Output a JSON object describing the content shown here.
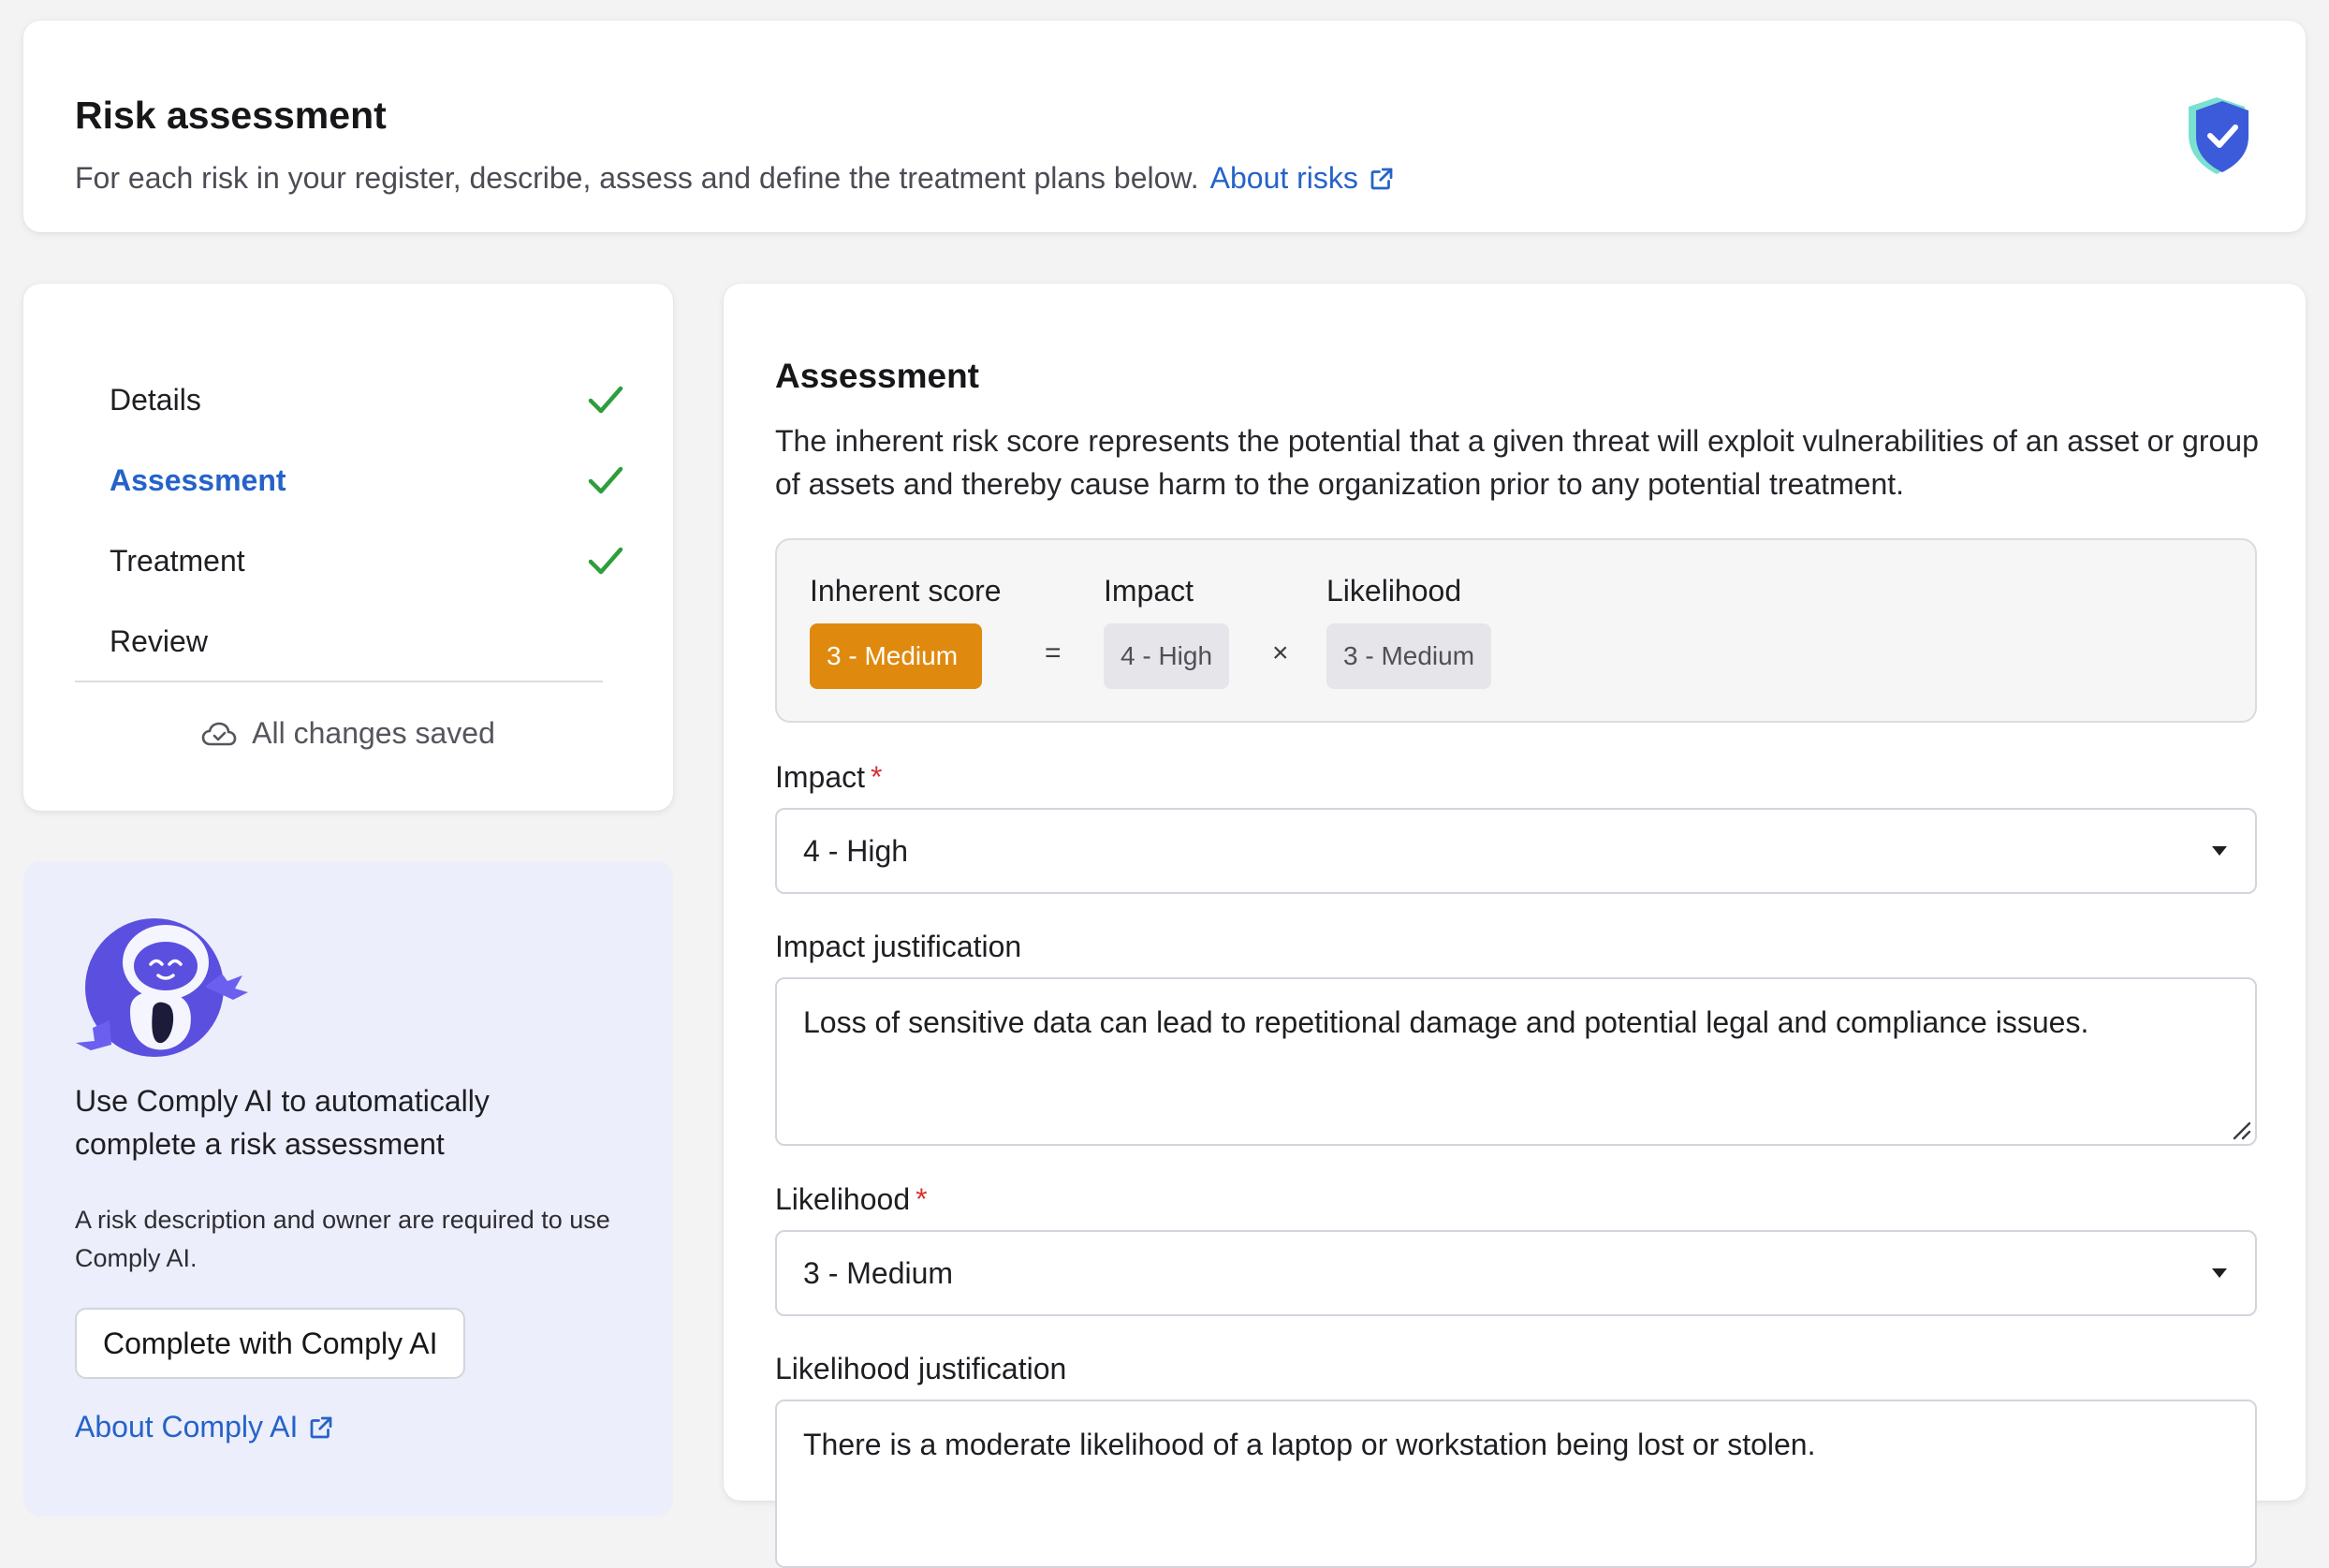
{
  "header": {
    "title": "Risk assessment",
    "subtitle": "For each risk in your register, describe, assess and define the treatment plans below.",
    "about_link": "About risks"
  },
  "steps": {
    "items": [
      {
        "label": "Details",
        "completed": true,
        "active": false
      },
      {
        "label": "Assessment",
        "completed": true,
        "active": true
      },
      {
        "label": "Treatment",
        "completed": true,
        "active": false
      },
      {
        "label": "Review",
        "completed": false,
        "active": false
      }
    ],
    "save_status": "All changes saved"
  },
  "comply_ai": {
    "title": "Use Comply AI to automatically complete a risk assessment",
    "note": "A risk description and owner are required to use Comply AI.",
    "button_label": "Complete with Comply AI",
    "about_link": "About Comply AI"
  },
  "assessment": {
    "title": "Assessment",
    "description": "The inherent risk score represents the potential that a given threat will exploit vulnerabilities of an asset or group of assets and thereby cause harm to the organization prior to any potential treatment.",
    "score": {
      "inherent_label": "Inherent score",
      "inherent_value": "3 - Medium",
      "equals": "=",
      "impact_label": "Impact",
      "impact_value": "4 - High",
      "times": "×",
      "likelihood_label": "Likelihood",
      "likelihood_value": "3 - Medium"
    },
    "impact_field": {
      "label": "Impact",
      "required_mark": "*",
      "value": "4 - High"
    },
    "impact_justification": {
      "label": "Impact justification",
      "value": "Loss of sensitive data can lead to repetitional damage and potential legal and compliance issues."
    },
    "likelihood_field": {
      "label": "Likelihood",
      "required_mark": "*",
      "value": "3 - Medium"
    },
    "likelihood_justification": {
      "label": "Likelihood justification",
      "value": "There is a moderate likelihood of a laptop or workstation being lost or stolen."
    }
  },
  "colors": {
    "accent_link": "#2563c9",
    "check_green": "#2e9e3c",
    "score_orange": "#df8a0e",
    "required_red": "#d93232",
    "ai_card_bg": "#eceefb"
  }
}
